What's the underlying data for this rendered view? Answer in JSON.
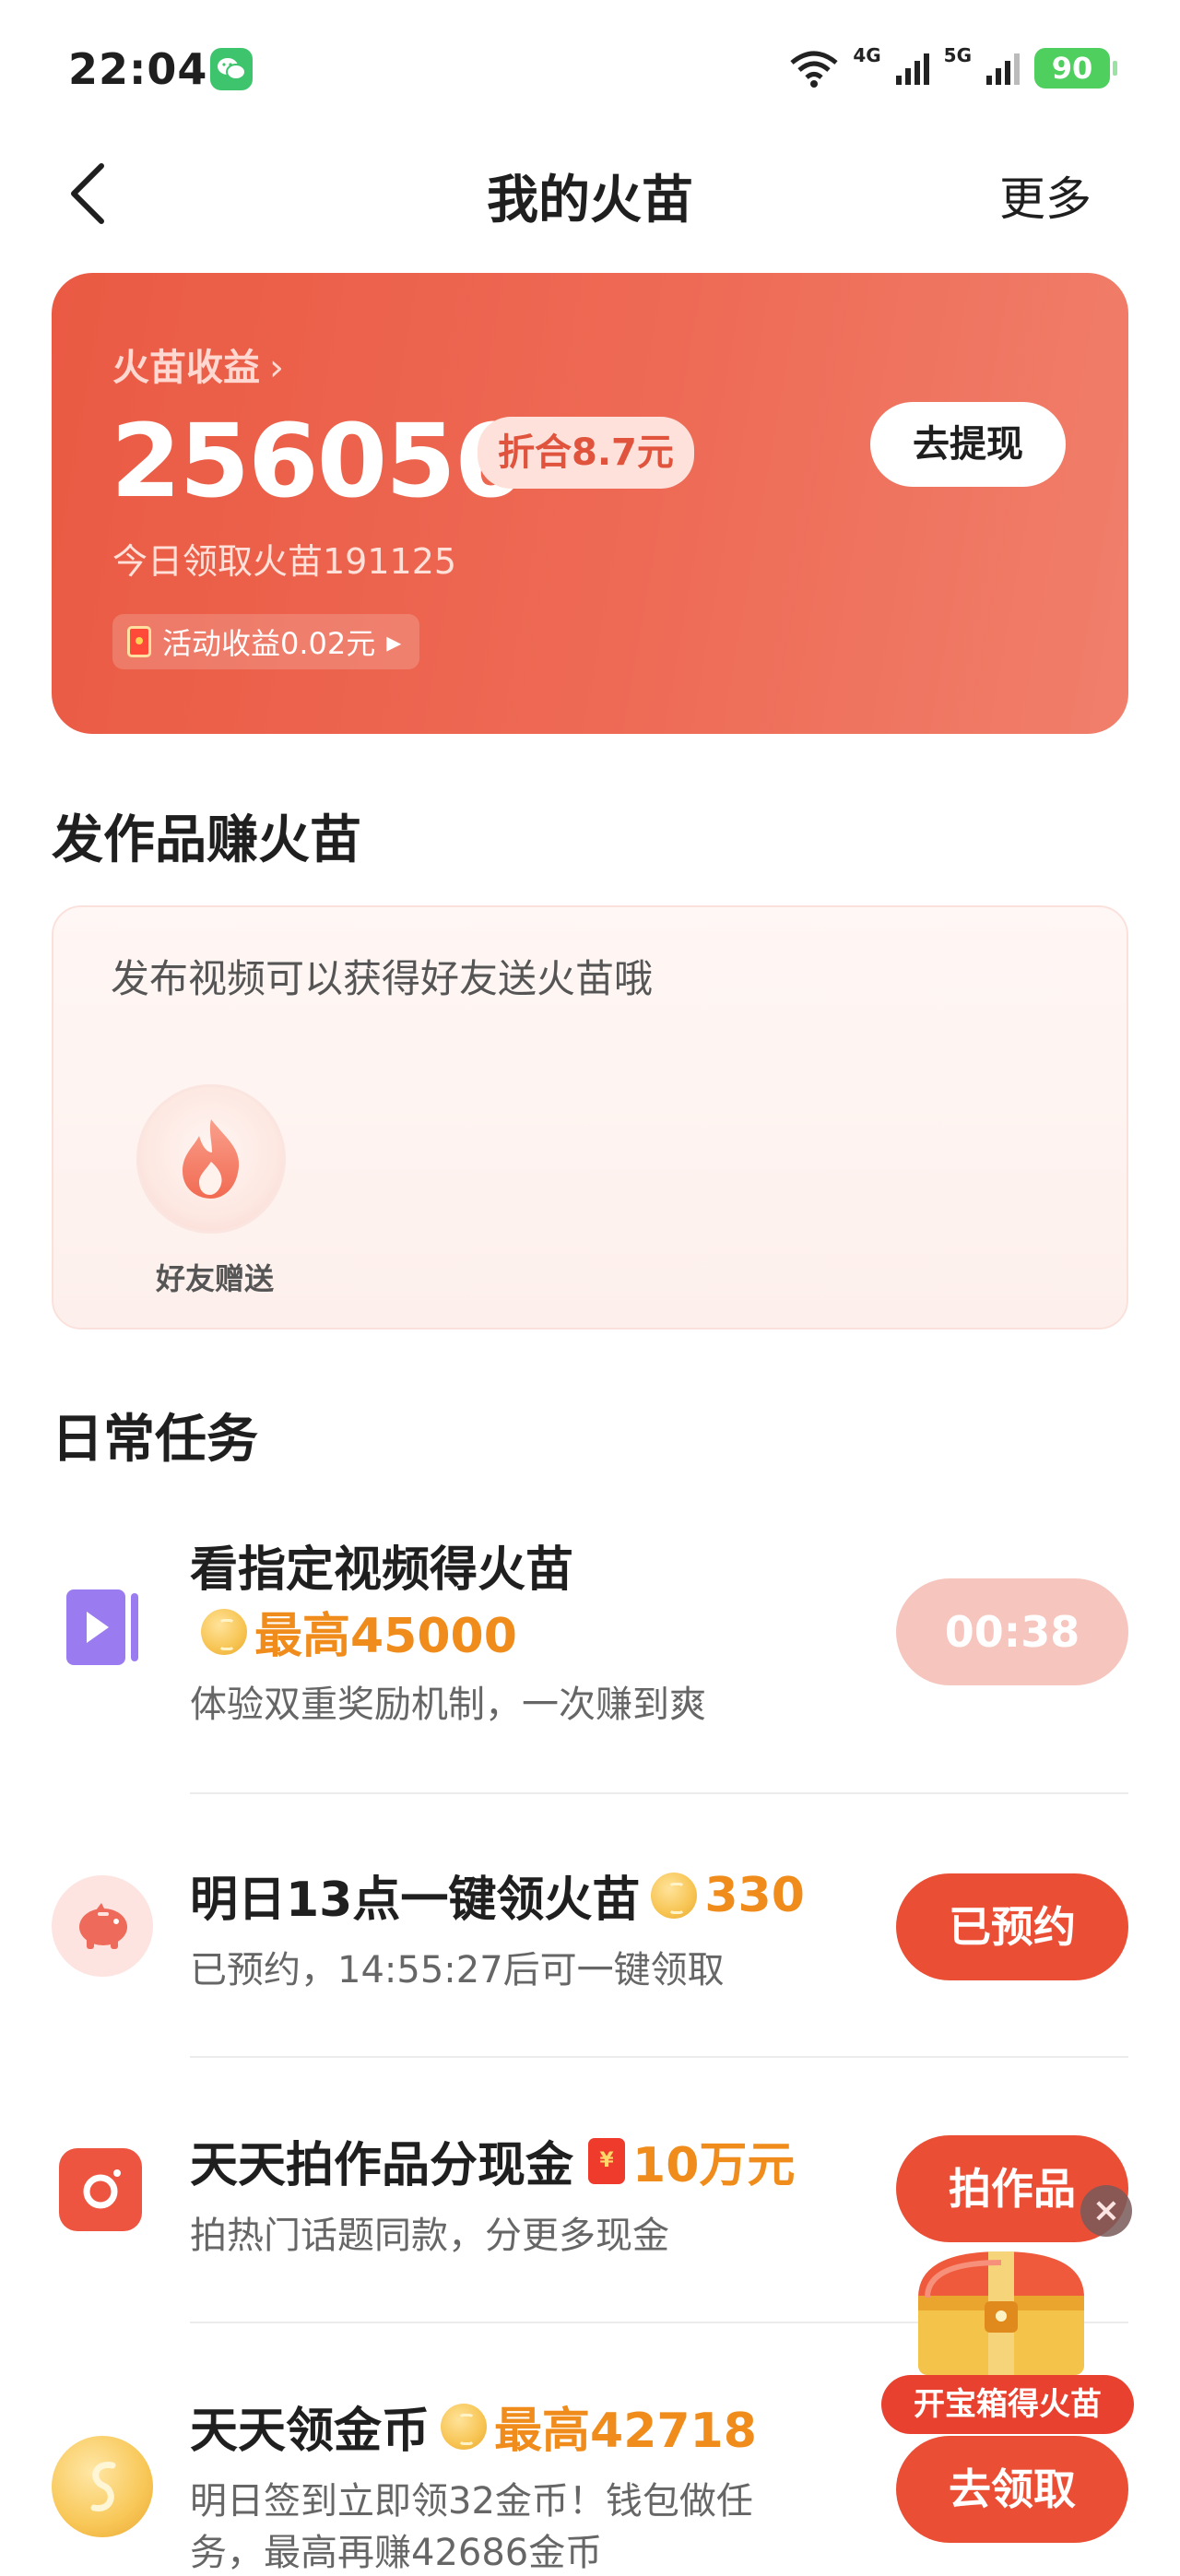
{
  "status_bar": {
    "time": "22:04",
    "net_a": "4G",
    "net_b": "5G",
    "battery": "90"
  },
  "nav": {
    "title": "我的火苗",
    "more": "更多"
  },
  "earnings": {
    "label": "火苗收益",
    "value": "256056",
    "worth": "折合8.7元",
    "withdraw": "去提现",
    "today": "今日领取火苗191125",
    "activity": "活动收益0.02元"
  },
  "works": {
    "section_title": "发作品赚火苗",
    "hint": "发布视频可以获得好友送火苗哦",
    "friend_label": "好友赠送"
  },
  "tasks": {
    "section_title": "日常任务",
    "items": [
      {
        "title": "看指定视频得火苗",
        "reward": "最高45000",
        "sub": "体验双重奖励机制，一次赚到爽",
        "button": "00:38",
        "icon": "video-play-icon"
      },
      {
        "title": "明日13点一键领火苗",
        "reward": "330",
        "sub": "已预约，14:55:27后可一键领取",
        "button": "已预约",
        "icon": "piggy-bank-icon"
      },
      {
        "title": "天天拍作品分现金",
        "reward": "10万元",
        "sub": "拍热门话题同款，分更多现金",
        "button": "拍作品",
        "icon": "camera-icon"
      },
      {
        "title": "天天领金币",
        "reward": "最高42718",
        "sub_line1": "明日签到立即领32金币！钱包做任",
        "sub_line2": "务，最高再赚42686金币",
        "button": "去领取",
        "icon": "gold-coin-icon"
      }
    ]
  },
  "treasure": {
    "label": "开宝箱得火苗",
    "close": "×"
  },
  "colors": {
    "accent": "#ea4f36",
    "reward": "#ef8c1b",
    "card_gradient_start": "#ea5a43",
    "card_gradient_end": "#f07f6b"
  }
}
